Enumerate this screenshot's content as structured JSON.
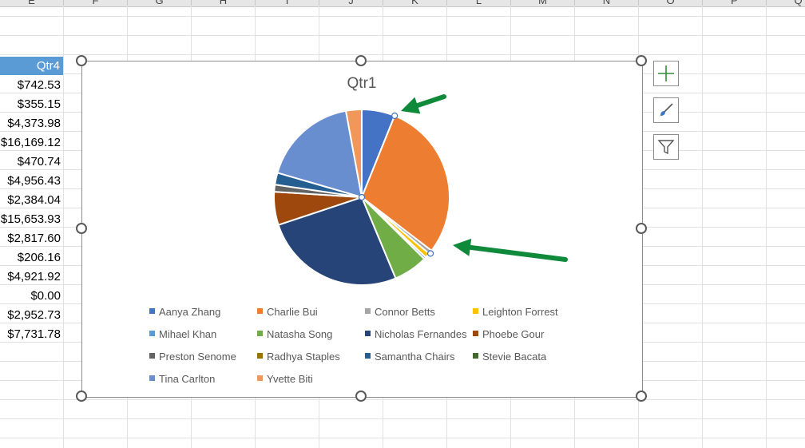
{
  "column_headers": [
    "E",
    "F",
    "G",
    "H",
    "I",
    "J",
    "K",
    "L",
    "M",
    "N",
    "O",
    "P",
    "Q"
  ],
  "column_e": {
    "header": "Qtr4",
    "values": [
      "$742.53",
      "$355.15",
      "$4,373.98",
      "$16,169.12",
      "$470.74",
      "$4,956.43",
      "$2,384.04",
      "$15,653.93",
      "$2,817.60",
      "$206.16",
      "$4,921.92",
      "$0.00",
      "$2,952.73",
      "$7,731.78"
    ]
  },
  "chart_tools": {
    "add_element_icon": "plus-icon",
    "styles_icon": "paintbrush-icon",
    "filter_icon": "funnel-icon"
  },
  "chart_data": {
    "type": "pie",
    "title": "Qtr1",
    "legend_position": "bottom",
    "slices": [
      {
        "name": "Aanya Zhang",
        "value": 6.1,
        "color": "#4472c4"
      },
      {
        "name": "Charlie Bui",
        "value": 29.3,
        "color": "#ed7d31"
      },
      {
        "name": "Connor Betts",
        "value": 0.7,
        "color": "#a5a5a5"
      },
      {
        "name": "Leighton Forrest",
        "value": 0.9,
        "color": "#ffc000"
      },
      {
        "name": "Mihael Khan",
        "value": 0.4,
        "color": "#5b9bd5"
      },
      {
        "name": "Natasha Song",
        "value": 6.3,
        "color": "#70ad47"
      },
      {
        "name": "Nicholas Fernandes",
        "value": 26.2,
        "color": "#264478"
      },
      {
        "name": "Phoebe Gour",
        "value": 6.1,
        "color": "#9e480e"
      },
      {
        "name": "Preston Senome",
        "value": 1.3,
        "color": "#636363"
      },
      {
        "name": "Radhya Staples",
        "value": 0.0,
        "color": "#997300"
      },
      {
        "name": "Samantha Chairs",
        "value": 2.2,
        "color": "#255e91"
      },
      {
        "name": "Stevie Bacata",
        "value": 0.0,
        "color": "#43682b"
      },
      {
        "name": "Tina Carlton",
        "value": 17.6,
        "color": "#698ed0"
      },
      {
        "name": "Yvette Biti",
        "value": 2.9,
        "color": "#f1975a"
      }
    ]
  },
  "annotations": {
    "arrow_color": "#0e8a3a"
  }
}
